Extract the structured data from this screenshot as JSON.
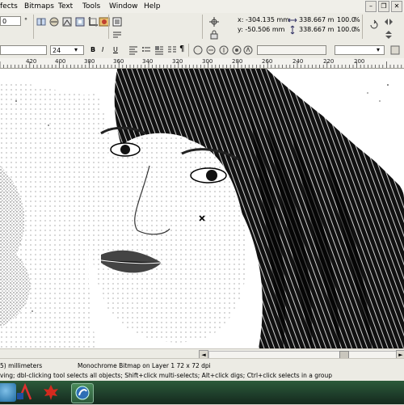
{
  "menu": {
    "items": [
      "fects",
      "Bitmaps",
      "Text",
      "Tools",
      "Window",
      "Help"
    ]
  },
  "propbar1": {
    "zoom_value": "0",
    "nudge_label": "°",
    "x_coord": "x: -304.135 mm",
    "y_coord": "y: -50.506 mm",
    "width_value": "338.667 m",
    "height_value": "338.667 m",
    "scale_x": "100.0",
    "scale_y": "100.0",
    "percent_label": "%"
  },
  "propbar2": {
    "font_size": "24"
  },
  "ruler": {
    "labels": [
      "420",
      "400",
      "380",
      "360",
      "340",
      "320",
      "300",
      "280",
      "260",
      "240",
      "220",
      "200"
    ]
  },
  "scrollbar": {
    "left_arrow": "◄",
    "right_arrow": "►"
  },
  "status": {
    "units": "5) millimeters",
    "object_info": "Monochrome Bitmap on Layer 1 72 x 72 dpi",
    "hint": "ving; dbl-clicking tool selects all objects; Shift+click multi-selects; Alt+click digs; Ctrl+click selects in a group"
  },
  "colors": {
    "menubar_bg": "#f0efe9",
    "toolbar_bg": "#ecebe4",
    "taskbar_bg": "#1e3d2a",
    "canvas_bg": "#ffffff"
  },
  "icons": [
    "hair-icon",
    "cursor-marker-icon",
    "start-orb-icon",
    "adobe-reader-icon",
    "app-maple-icon",
    "coreldraw-icon"
  ]
}
